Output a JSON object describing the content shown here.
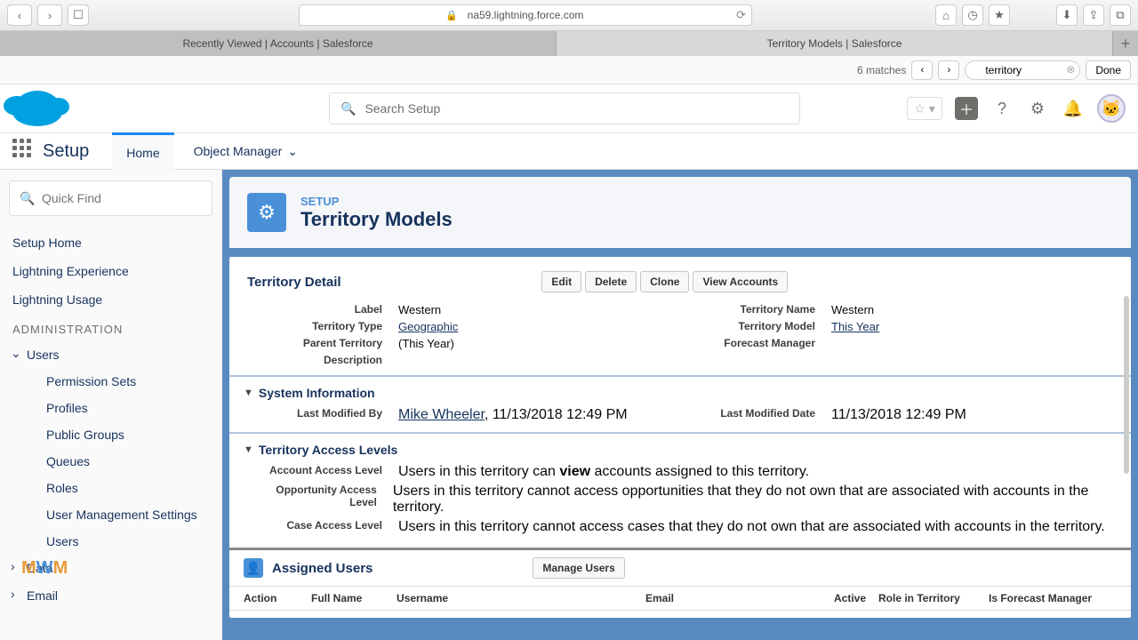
{
  "browser": {
    "url": "na59.lightning.force.com",
    "tabs": [
      "Recently Viewed | Accounts | Salesforce",
      "Territory Models | Salesforce"
    ],
    "find": {
      "matches": "6 matches",
      "value": "territory",
      "done": "Done"
    }
  },
  "header": {
    "search_placeholder": "Search Setup"
  },
  "nav": {
    "app_name": "Setup",
    "home": "Home",
    "obj_mgr": "Object Manager"
  },
  "sidebar": {
    "quick_find": "Quick Find",
    "links": [
      "Setup Home",
      "Lightning Experience",
      "Lightning Usage"
    ],
    "section": "ADMINISTRATION",
    "users": "Users",
    "users_sub": [
      "Permission Sets",
      "Profiles",
      "Public Groups",
      "Queues",
      "Roles",
      "User Management Settings",
      "Users"
    ],
    "data": "Data",
    "email": "Email"
  },
  "page": {
    "breadcrumb": "SETUP",
    "title": "Territory Models",
    "section_detail": "Territory Detail",
    "buttons": {
      "edit": "Edit",
      "delete": "Delete",
      "clone": "Clone",
      "view_accounts": "View Accounts"
    },
    "fields": {
      "label_l": "Label",
      "label_v": "Western",
      "terrname_l": "Territory Name",
      "terrname_v": "Western",
      "terrtype_l": "Territory Type",
      "terrtype_v": "Geographic",
      "terrmodel_l": "Territory Model",
      "terrmodel_v": "This Year",
      "parent_l": "Parent Territory",
      "parent_v": "(This Year)",
      "forecast_l": "Forecast Manager",
      "forecast_v": "",
      "desc_l": "Description",
      "desc_v": ""
    },
    "sys_info": "System Information",
    "sys": {
      "lmb_l": "Last Modified By",
      "lmb_user": "Mike Wheeler",
      "lmb_date": ", 11/13/2018 12:49 PM",
      "lmd_l": "Last Modified Date",
      "lmd_v": "11/13/2018 12:49 PM"
    },
    "access": {
      "title": "Territory Access Levels",
      "acc_l": "Account Access Level",
      "acc_v1": "Users in this territory can ",
      "acc_vb": "view",
      "acc_v2": " accounts assigned to this territory.",
      "opp_l": "Opportunity Access Level",
      "opp_v": "Users in this territory cannot access opportunities that they do not own that are associated with accounts in the territory.",
      "case_l": "Case Access Level",
      "case_v": "Users in this territory cannot access cases that they do not own that are associated with accounts in the territory."
    },
    "assigned": {
      "title": "Assigned Users",
      "manage": "Manage Users",
      "cols": {
        "action": "Action",
        "fullname": "Full Name",
        "username": "Username",
        "email": "Email",
        "active": "Active",
        "role": "Role in Territory",
        "forecast": "Is Forecast Manager"
      }
    }
  }
}
